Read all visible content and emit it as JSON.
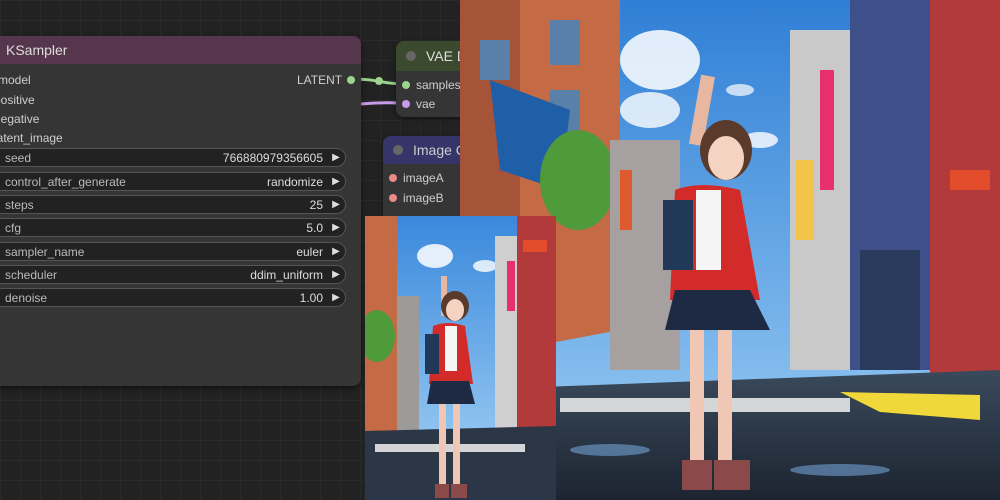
{
  "ksampler": {
    "title": "KSampler",
    "inputs": [
      "model",
      "positive",
      "negative",
      "latent_image"
    ],
    "output": "LATENT",
    "widgets": [
      {
        "label": "seed",
        "value": "766880979356605"
      },
      {
        "label": "control_after_generate",
        "value": "randomize"
      },
      {
        "label": "steps",
        "value": "25"
      },
      {
        "label": "cfg",
        "value": "5.0"
      },
      {
        "label": "sampler_name",
        "value": "euler"
      },
      {
        "label": "scheduler",
        "value": "ddim_uniform"
      },
      {
        "label": "denoise",
        "value": "1.00"
      }
    ]
  },
  "vae_decode": {
    "title": "VAE D",
    "inputs": [
      "samples",
      "vae"
    ]
  },
  "image_compare": {
    "title": "Image C",
    "inputs": [
      "imageA",
      "imageB"
    ]
  },
  "colors": {
    "latent_link": "#9bd48a",
    "vae_link": "#c89be8",
    "image_slot": "#e88a8a"
  }
}
